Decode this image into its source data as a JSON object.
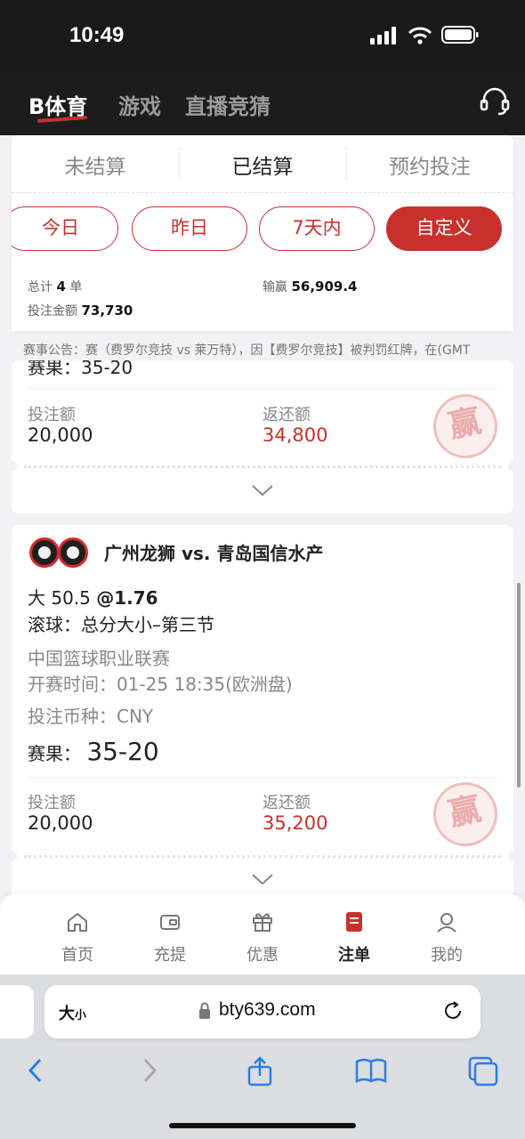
{
  "status": {
    "time": "10:49"
  },
  "topnav": {
    "tabs": [
      {
        "label": "B体育"
      },
      {
        "label": "游戏"
      },
      {
        "label": "直播竞猜"
      }
    ]
  },
  "subtabs": [
    {
      "label": "未结算"
    },
    {
      "label": "已结算"
    },
    {
      "label": "预约投注"
    }
  ],
  "date_filters": [
    {
      "label": "今日"
    },
    {
      "label": "昨日"
    },
    {
      "label": "7天内"
    },
    {
      "label": "自定义"
    }
  ],
  "summary": {
    "total_label": "总计",
    "total_count": "4",
    "total_unit": "单",
    "stake_label": "投注金额",
    "stake_value": "73,730",
    "winloss_label": "输赢",
    "winloss_value": "56,909.4"
  },
  "notice": "赛事公告：赛（费罗尔竞技 vs 莱万特），因【费罗尔竞技】被判罚红牌，在(GMT",
  "bets": [
    {
      "result_partial": "赛果：35-20",
      "stake_label": "投注额",
      "stake": "20,000",
      "return_label": "返还额",
      "return": "34,800",
      "stamp": "赢"
    },
    {
      "match": "广州龙狮 vs. 青岛国信水产",
      "selection": "大 50.5",
      "odds": "@1.76",
      "market": "滚球：总分大小–第三节",
      "league": "中国篮球职业联赛",
      "start_time": "开赛时间：01-25 18:35(欧洲盘)",
      "currency": "投注币种：CNY",
      "result_label": "赛果：",
      "result_score": "35-20",
      "stake_label": "投注额",
      "stake": "20,000",
      "return_label": "返还额",
      "return": "35,200",
      "stamp": "赢"
    }
  ],
  "tabbar": [
    {
      "label": "首页",
      "icon": "home-icon"
    },
    {
      "label": "充提",
      "icon": "wallet-icon"
    },
    {
      "label": "优惠",
      "icon": "gift-icon"
    },
    {
      "label": "注单",
      "icon": "betslip-icon"
    },
    {
      "label": "我的",
      "icon": "user-icon"
    }
  ],
  "browser": {
    "text_size_label": "大",
    "text_size_small": "小",
    "url": "bty639.com"
  },
  "colors": {
    "accent": "#c9302c",
    "dark": "#1c1c1c"
  }
}
